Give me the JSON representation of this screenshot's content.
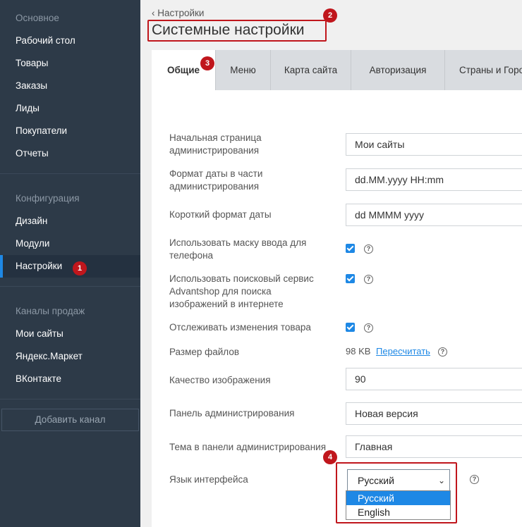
{
  "sidebar": {
    "sections": [
      "Основное",
      "Конфигурация",
      "Каналы продаж"
    ],
    "main_items": [
      "Рабочий стол",
      "Товары",
      "Заказы",
      "Лиды",
      "Покупатели",
      "Отчеты"
    ],
    "config_items": [
      "Дизайн",
      "Модули",
      "Настройки"
    ],
    "channel_items": [
      "Мои сайты",
      "Яндекс.Маркет",
      "ВКонтакте"
    ],
    "add_channel": "Добавить канал"
  },
  "annotations": [
    "1",
    "2",
    "3",
    "4"
  ],
  "header": {
    "back_label": "Настройки",
    "title": "Системные настройки"
  },
  "tabs": [
    "Общие",
    "Меню",
    "Карта сайта",
    "Авторизация",
    "Страны и Горо"
  ],
  "form": {
    "start_page_label": "Начальная страница администрирования",
    "start_page_value": "Мои сайты",
    "date_format_label": "Формат даты в части администрирования",
    "date_format_value": "dd.MM.yyyy HH:mm",
    "short_date_label": "Короткий формат даты",
    "short_date_value": "dd MMMM yyyy",
    "phone_mask_label": "Использовать маску ввода для телефона",
    "image_search_label": "Использовать поисковый сервис Advantshop для поиска изображений в интернете",
    "track_changes_label": "Отслеживать изменения товара",
    "file_size_label": "Размер файлов",
    "file_size_value": "98 KB",
    "recalc_link": "Пересчитать",
    "image_quality_label": "Качество изображения",
    "image_quality_value": "90",
    "admin_panel_label": "Панель администрирования",
    "admin_panel_value": "Новая версия",
    "theme_label": "Тема в панели администрирования",
    "theme_value": "Главная",
    "language_label": "Язык интерфейса",
    "language_value": "Русский",
    "language_options": [
      "Русский",
      "English"
    ]
  },
  "colors": {
    "sidebar": "#2d3a48",
    "accent": "#1e88e5",
    "annotation": "#c0161c"
  },
  "icons": {
    "back": "chevron-left-icon",
    "help": "question-circle-icon",
    "select": "chevron-down-icon"
  }
}
